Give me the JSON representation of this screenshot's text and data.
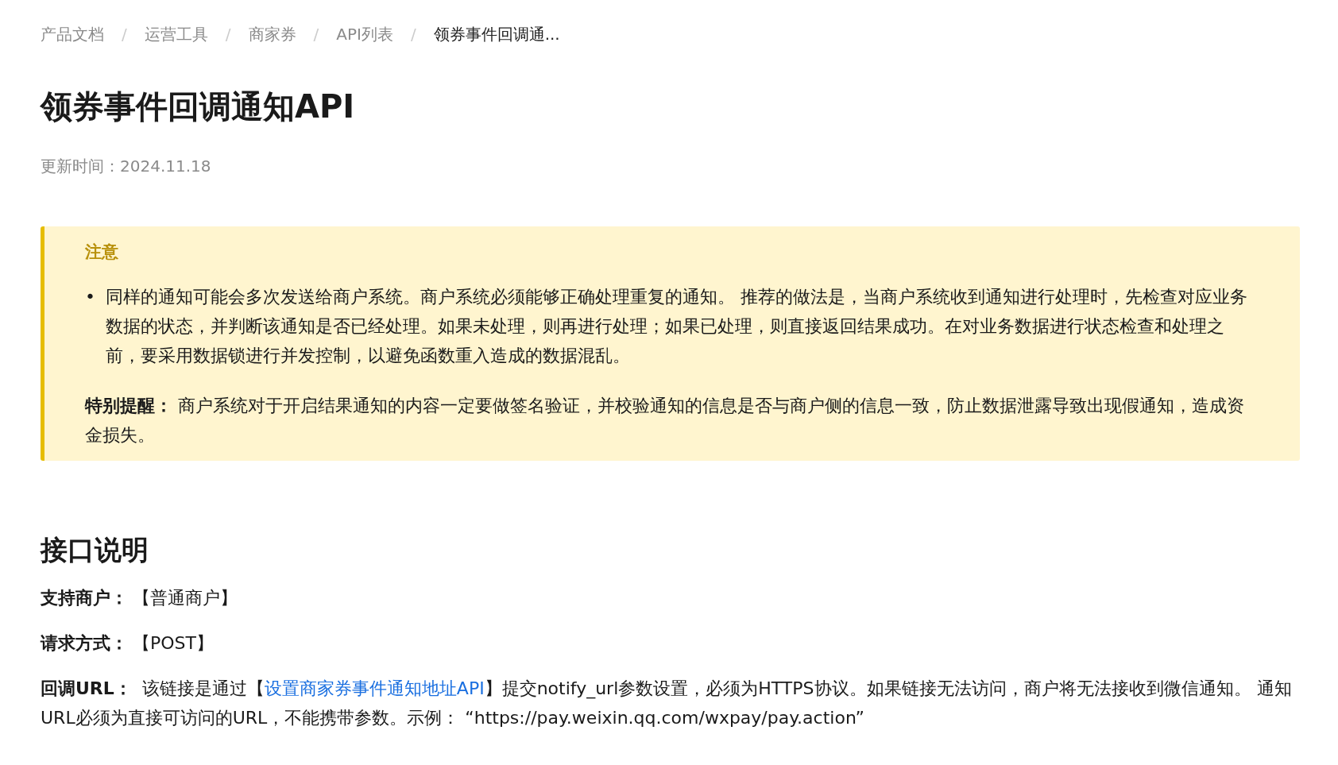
{
  "breadcrumb": [
    {
      "label": "产品文档",
      "separator": "/",
      "current": false
    },
    {
      "label": "运营工具",
      "separator": "/",
      "current": false
    },
    {
      "label": "商家券",
      "separator": "/",
      "current": false
    },
    {
      "label": "API列表",
      "separator": "/",
      "current": false
    },
    {
      "label": "领券事件回调通...",
      "current": true
    }
  ],
  "title": "领券事件回调通知API",
  "updated": "更新时间：2024.11.18",
  "notice": {
    "heading": "注意",
    "bullets": [
      {
        "marker": "•",
        "text": "同样的通知可能会多次发送给商户系统。商户系统必须能够正确处理重复的通知。 推荐的做法是，当商户系统收到通知进行处理时，先检查对应业务数据的状态，并判断该通知是否已经处理。如果未处理，则再进行处理；如果已处理，则直接返回结果成功。在对业务数据进行状态检查和处理之前，要采用数据锁进行并发控制，以避免函数重入造成的数据混乱。"
      }
    ],
    "reminder": "**特别提醒：** 商户系统对于开启结果通知的内容一定要做签名验证，并校验通知的信息是否与商户侧的信息一致，防止数据泄露导致出现假通知，造成资金损失。"
  },
  "section": {
    "heading": "接口说明",
    "fields": [
      {
        "label": "支持商户：",
        "value": "【普通商户】"
      },
      {
        "label": "请求方式：",
        "value": "【POST】"
      }
    ],
    "callback": {
      "label": "回调URL：",
      "before": "该链接是通过【",
      "link": "设置商家券事件通知地址API",
      "after": "】提交notify_url参数设置，必须为HTTPS协议。如果链接无法访问，商户将无法接收到微信通知。 通知URL必须为直接可访问的URL，不能携带参数。示例： “https://pay.weixin.qq.com/wxpay/pay.action”"
    }
  }
}
